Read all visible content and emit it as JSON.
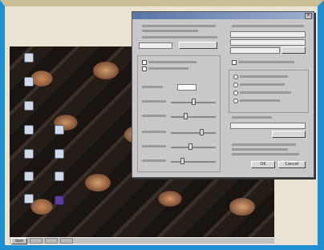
{
  "taskbar": {
    "start_label": "Start",
    "clock": "",
    "slot_count": 3
  },
  "dialog": {
    "buttons": {
      "ok_label": "OK",
      "cancel_label": "Cancel"
    }
  },
  "colors": {
    "frame": "#1e8fd0",
    "titlebar": "#5a74a8",
    "dialog_bg": "#c8c8c8"
  }
}
